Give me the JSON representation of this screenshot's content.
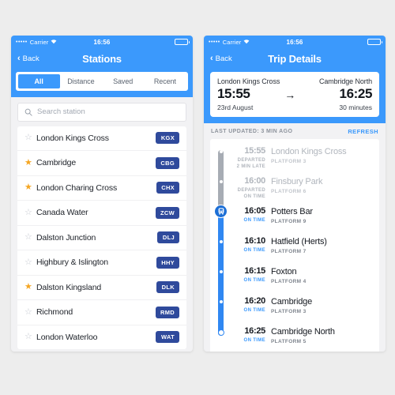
{
  "status_bar": {
    "signal_dots": "•••••",
    "carrier": "Carrier",
    "wifi_icon": "wifi-icon",
    "time": "16:56"
  },
  "stations_screen": {
    "nav": {
      "back_label": "Back",
      "title": "Stations"
    },
    "filters": [
      {
        "label": "All",
        "active": true
      },
      {
        "label": "Distance",
        "active": false
      },
      {
        "label": "Saved",
        "active": false
      },
      {
        "label": "Recent",
        "active": false
      }
    ],
    "search": {
      "placeholder": "Search station",
      "value": "",
      "icon": "search-icon"
    },
    "stations": [
      {
        "name": "London Kings Cross",
        "code": "KGX",
        "saved": false
      },
      {
        "name": "Cambridge",
        "code": "CBG",
        "saved": true
      },
      {
        "name": "London Charing Cross",
        "code": "CHX",
        "saved": true
      },
      {
        "name": "Canada Water",
        "code": "ZCW",
        "saved": false
      },
      {
        "name": "Dalston Junction",
        "code": "DLJ",
        "saved": false
      },
      {
        "name": "Highbury & Islington",
        "code": "HHY",
        "saved": false
      },
      {
        "name": "Dalston Kingsland",
        "code": "DLK",
        "saved": true
      },
      {
        "name": "Richmond",
        "code": "RMD",
        "saved": false
      },
      {
        "name": "London Waterloo",
        "code": "WAT",
        "saved": false
      }
    ]
  },
  "trip_screen": {
    "nav": {
      "back_label": "Back",
      "title": "Trip Details"
    },
    "summary": {
      "origin_station": "London Kings Cross",
      "origin_time": "15:55",
      "origin_date": "23rd August",
      "arrow": "→",
      "destination_station": "Cambridge North",
      "destination_time": "16:25",
      "duration": "30 minutes"
    },
    "updated": {
      "text": "LAST UPDATED: 3 MIN AGO",
      "refresh_label": "REFRESH"
    },
    "stops": [
      {
        "time": "15:55",
        "name": "London Kings Cross",
        "status": "DEPARTED\n2 MIN LATE",
        "platform": "PLATFORM 3",
        "state": "past",
        "marker": "dot"
      },
      {
        "time": "16:00",
        "name": "Finsbury Park",
        "status": "DEPARTED\nON TIME",
        "platform": "PLATFORM 6",
        "state": "past",
        "marker": "dot"
      },
      {
        "time": "16:05",
        "name": "Potters Bar",
        "status": "ON TIME",
        "platform": "PLATFORM 9",
        "state": "current",
        "marker": "train-icon"
      },
      {
        "time": "16:10",
        "name": "Hatfield (Herts)",
        "status": "ON TIME",
        "platform": "PLATFORM 7",
        "state": "upcoming",
        "marker": "dot"
      },
      {
        "time": "16:15",
        "name": "Foxton",
        "status": "ON TIME",
        "platform": "PLATFORM 4",
        "state": "upcoming",
        "marker": "dot"
      },
      {
        "time": "16:20",
        "name": "Cambridge",
        "status": "ON TIME",
        "platform": "PLATFORM 3",
        "state": "upcoming",
        "marker": "dot"
      },
      {
        "time": "16:25",
        "name": "Cambridge North",
        "status": "ON TIME",
        "platform": "PLATFORM 5",
        "state": "upcoming",
        "marker": "dot-terminus"
      }
    ]
  },
  "colors": {
    "accent_blue": "#3b99fc",
    "badge_navy": "#2f4a9c",
    "star_gold": "#f5a623",
    "rail_gray": "#a7acb4",
    "rail_active": "#2f87f2",
    "page_bg": "#ededed"
  }
}
